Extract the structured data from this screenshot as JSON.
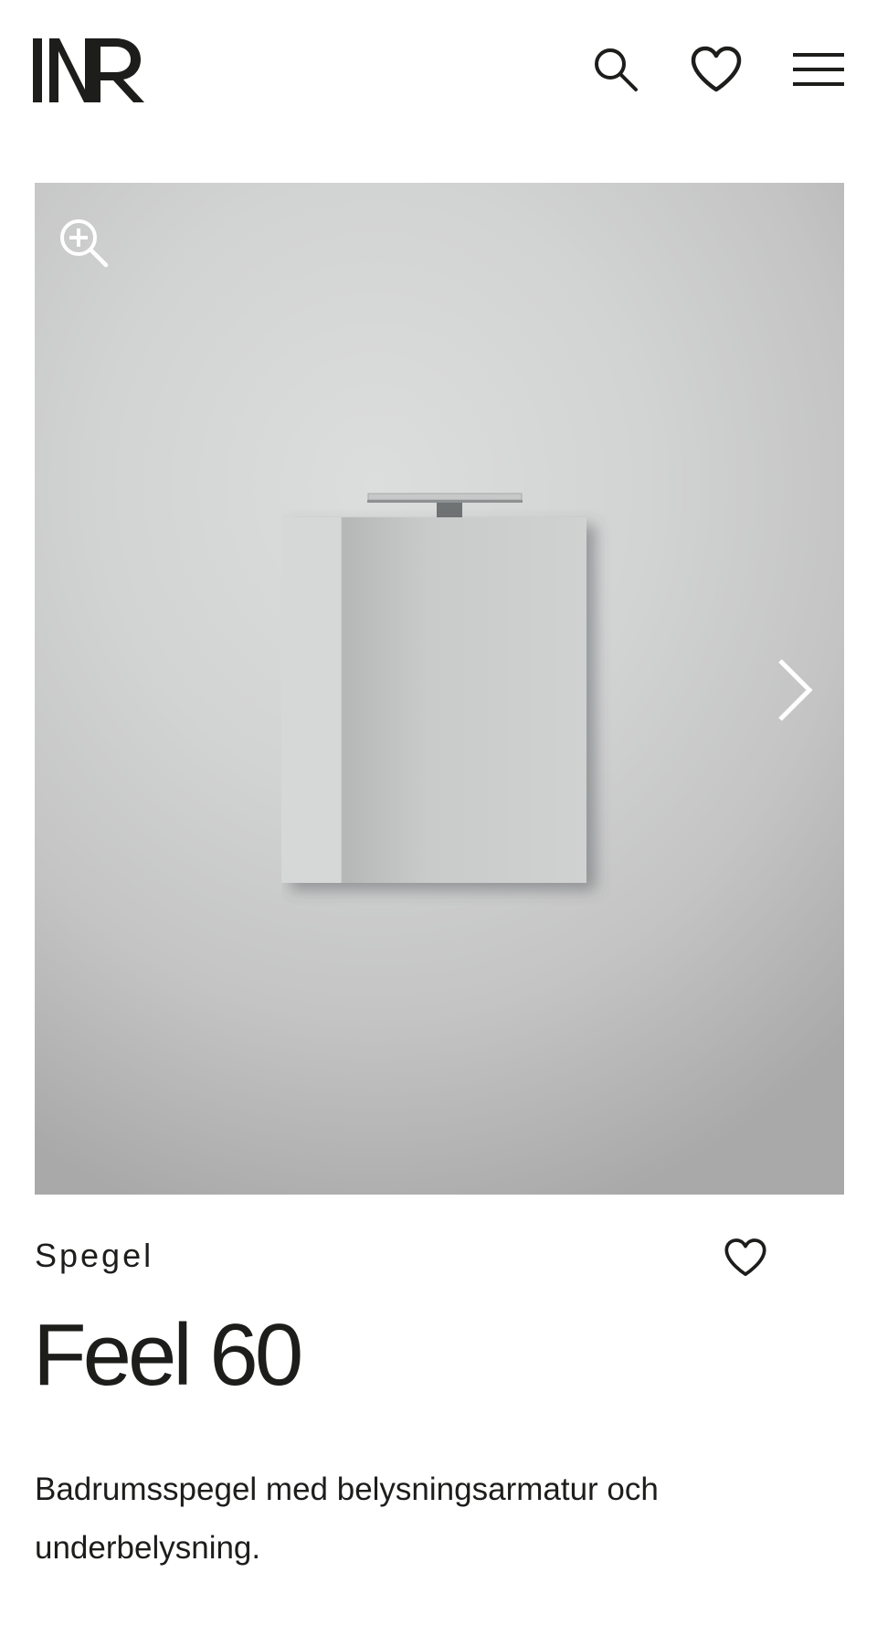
{
  "header": {
    "logo_text": "INR",
    "icons": {
      "search": "search-icon",
      "favorites": "heart-icon",
      "menu": "hamburger-menu-icon"
    }
  },
  "gallery": {
    "icons": {
      "zoom": "zoom-in-icon",
      "next": "chevron-right-icon"
    }
  },
  "product": {
    "category": "Spegel",
    "name": "Feel 60",
    "description": "Badrumsspegel med belysningsarmatur och underbelysning.",
    "favorite_icon": "heart-icon"
  },
  "colors": {
    "text": "#1d1d1b",
    "background": "#ffffff",
    "icon_on_image": "#ffffff"
  }
}
